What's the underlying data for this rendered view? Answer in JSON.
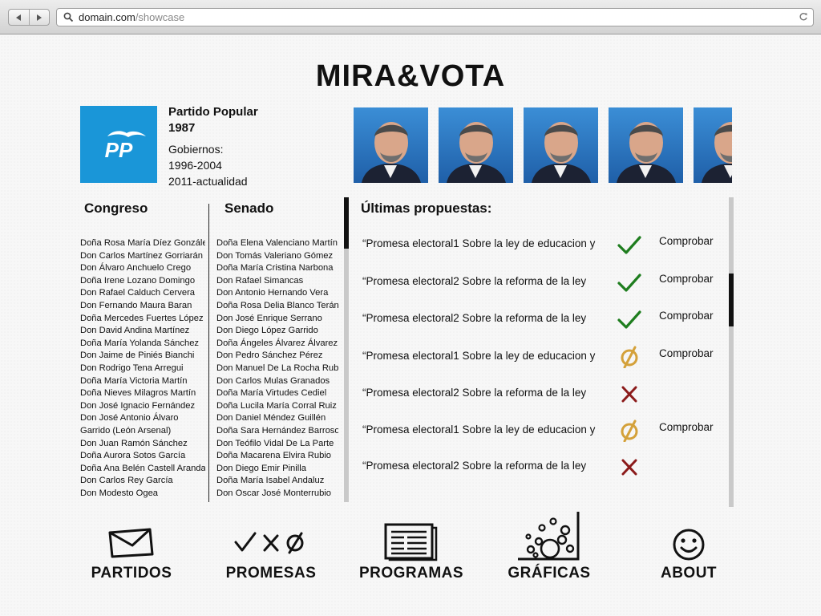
{
  "browser": {
    "url_domain": "domain.com",
    "url_path": "/showcase"
  },
  "site": {
    "title": "MIRA&VOTA"
  },
  "party": {
    "logo_text": "PP",
    "name": "Partido Popular",
    "founded": "1987",
    "gov_label": "Gobiernos:",
    "gov_periods": [
      "1996-2004",
      "2011-actualidad"
    ],
    "brand_color": "#1a96d8"
  },
  "columns": {
    "congreso_label": "Congreso",
    "senado_label": "Senado",
    "propuestas_label": "Últimas propuestas:"
  },
  "congreso": [
    "Doña Rosa María Díez González",
    "Don Carlos Martínez Gorriarán",
    "Don Álvaro Anchuelo Crego",
    "Doña Irene Lozano Domingo",
    "Don Rafael Calduch Cervera",
    "Don Fernando Maura Baran",
    "Doña Mercedes Fuertes López",
    "Don David Andina Martínez",
    "Doña María Yolanda Sánchez",
    "Don Jaime de Piniés Bianchi",
    "Don Rodrigo Tena Arregui",
    "Doña María Victoria Martín",
    "Doña Nieves Milagros Martín",
    "Don José Ignacio Fernández",
    "Don José Antonio Álvaro",
    "Garrido (León Arsenal)",
    "Don Juan Ramón Sánchez",
    "Doña Aurora Sotos García",
    "Doña Ana Belén Castell Aranda",
    "Don Carlos Rey García",
    "Don Modesto Ogea"
  ],
  "senado": [
    "Doña Elena Valenciano Martín",
    "Don Tomás Valeriano Gómez",
    "Doña María Cristina Narbona",
    "Don Rafael Simancas",
    "Don Antonio Hernando Vera",
    "Doña Rosa Delia Blanco Terán",
    "Don José Enrique Serrano",
    "Don Diego López Garrido",
    "Doña Ángeles Álvarez Álvarez",
    "Don Pedro Sánchez Pérez",
    "Don Manuel De La Rocha Rubí",
    "Don Carlos Mulas Granados",
    "Doña María Virtudes Cediel",
    "Doña Lucila María Corral Ruiz",
    "Don Daniel Méndez Guillén",
    "Doña Sara Hernández Barroso",
    "Don Teófilo Vidal De La Parte",
    "Doña Macarena Elvira Rubio",
    "Don Diego Emir Pinilla",
    "Doña María Isabel Andaluz",
    "Don Oscar José Monterrubio"
  ],
  "propuestas": [
    {
      "text": "“Promesa  electoral1 Sobre la ley de educacion y",
      "status": "check-icon",
      "link": "Comprobar"
    },
    {
      "text": "“Promesa  electoral2 Sobre la reforma de la ley",
      "status": "check-icon",
      "link": "Comprobar"
    },
    {
      "text": "“Promesa  electoral2 Sobre la reforma de la ley",
      "status": "check-icon",
      "link": "Comprobar"
    },
    {
      "text": "“Promesa  electoral1 Sobre la ley de educacion y",
      "status": "null-icon",
      "link": "Comprobar"
    },
    {
      "text": "“Promesa  electoral2 Sobre la reforma de la ley",
      "status": "cross-icon",
      "link": ""
    },
    {
      "text": "“Promesa  electoral1 Sobre la ley de educacion y",
      "status": "null-icon",
      "link": "Comprobar"
    },
    {
      "text": "“Promesa  electoral2 Sobre la reforma de la ley",
      "status": "cross-icon",
      "link": ""
    }
  ],
  "status_colors": {
    "check": "#1e7d1e",
    "null": "#d4a13a",
    "cross": "#8b1a1a"
  },
  "nav": [
    {
      "label": "PARTIDOS",
      "icon": "envelope-icon"
    },
    {
      "label": "PROMESAS",
      "icon": "promesas-icon"
    },
    {
      "label": "PROGRAMAS",
      "icon": "documents-icon"
    },
    {
      "label": "GRÁFICAS",
      "icon": "chart-bubbles-icon"
    },
    {
      "label": "ABOUT",
      "icon": "smiley-icon"
    }
  ]
}
